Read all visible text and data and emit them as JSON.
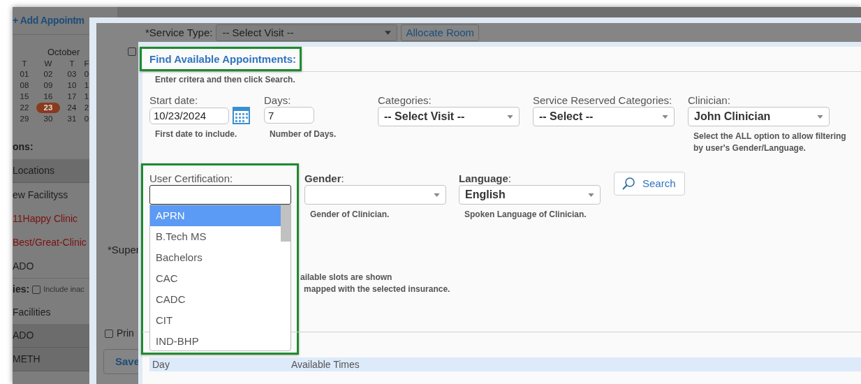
{
  "background_app": {
    "add_button": "+ Add Appointm",
    "calendar": {
      "month": "October",
      "weekdays": [
        "T",
        "W",
        "T",
        "F"
      ],
      "weeks": [
        [
          {
            "day": "01",
            "selected": false
          },
          {
            "day": "02",
            "selected": false
          },
          {
            "day": "03",
            "selected": false
          },
          {
            "day": "0",
            "selected": false
          }
        ],
        [
          {
            "day": "08",
            "selected": false
          },
          {
            "day": "09",
            "selected": false
          },
          {
            "day": "10",
            "selected": false
          },
          {
            "day": "1",
            "selected": false
          }
        ],
        [
          {
            "day": "15",
            "selected": false
          },
          {
            "day": "16",
            "selected": false
          },
          {
            "day": "17",
            "selected": false
          },
          {
            "day": "1",
            "selected": false
          }
        ],
        [
          {
            "day": "22",
            "selected": false
          },
          {
            "day": "23",
            "selected": true
          },
          {
            "day": "24",
            "selected": false
          },
          {
            "day": "2",
            "selected": false
          }
        ],
        [
          {
            "day": "29",
            "selected": false
          },
          {
            "day": "30",
            "selected": false
          },
          {
            "day": "31",
            "selected": false
          },
          {
            "day": "0",
            "selected": false
          }
        ]
      ]
    },
    "locations_label": "ons:",
    "locations": [
      {
        "label": "Locations",
        "kind": "header"
      },
      {
        "label": "ew Facilityss",
        "kind": "plain"
      },
      {
        "label": "11Happy Clinic",
        "kind": "alert"
      },
      {
        "label": "Best/Great-Clinic",
        "kind": "alert"
      },
      {
        "label": "ADO",
        "kind": "plain"
      }
    ],
    "facilities_label": "ies:",
    "include_inactive": {
      "label": "Include inac",
      "checked": false
    },
    "facilities": [
      {
        "label": "Facilities",
        "kind": "plain"
      },
      {
        "label": "ADO",
        "kind": "header"
      },
      {
        "label": "METH",
        "kind": "header"
      }
    ]
  },
  "service_dialog": {
    "service_type_label": "*Service Type:",
    "service_type_value": "-- Select Visit --",
    "allocate_button": "Allocate Room",
    "top_checkbox": {
      "checked": false
    },
    "supervisor_label": "*Super",
    "print": {
      "label": "Prin",
      "checked": false
    },
    "save_button": "Save"
  },
  "find_dialog": {
    "title": "Find Available Appointments:",
    "subtitle": "Enter critera and then click Search.",
    "start_date": {
      "label": "Start date:",
      "value": "10/23/2024",
      "help": "First date to include."
    },
    "days": {
      "label": "Days:",
      "value": "7",
      "help": "Number of Days."
    },
    "categories": {
      "label": "Categories:",
      "value": "-- Select Visit --"
    },
    "reserved_categories": {
      "label": "Service Reserved Categories:",
      "value": "-- Select --"
    },
    "clinician": {
      "label": "Clinician:",
      "value": "John Clinician",
      "help": "Select the **ALL** option to allow filtering by user's Gender/Language."
    },
    "user_certification": {
      "label": "User Certification:",
      "options": [
        {
          "label": "APRN",
          "selected": true
        },
        {
          "label": "B.Tech MS",
          "selected": false
        },
        {
          "label": "Bachelors",
          "selected": false
        },
        {
          "label": "CAC",
          "selected": false
        },
        {
          "label": "CADC",
          "selected": false
        },
        {
          "label": "CIT",
          "selected": false
        },
        {
          "label": "IND-BHP",
          "selected": false
        }
      ]
    },
    "gender": {
      "label": "Gender:",
      "help": "Gender of Clinician."
    },
    "language": {
      "label": "Language:",
      "value": "English",
      "help": "Spoken Language of Clinician."
    },
    "search_button": "Search",
    "note_lines": [
      "ailable slots are shown",
      "mapped with the selected insurance."
    ],
    "table": {
      "columns": [
        "Day",
        "Available Times"
      ]
    }
  }
}
